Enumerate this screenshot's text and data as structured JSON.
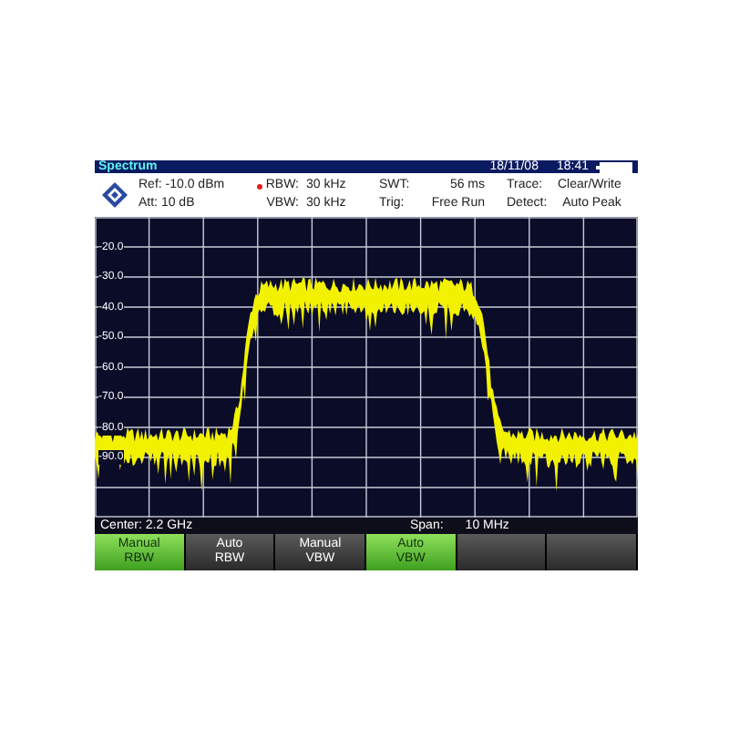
{
  "title_bar": {
    "title": "Spectrum",
    "date": "18/11/08",
    "time": "18:41"
  },
  "header": {
    "ref": "Ref: -10.0 dBm",
    "att": "Att: 10 dB",
    "rbw_label": "RBW:",
    "rbw_value": "30 kHz",
    "rbw_marked": true,
    "vbw_label": "VBW:",
    "vbw_value": "30 kHz",
    "swt_label": "SWT:",
    "swt_value": "56 ms",
    "trig_label": "Trig:",
    "trig_value": "Free Run",
    "trace_label": "Trace:",
    "trace_value": "Clear/Write",
    "detect_label": "Detect:",
    "detect_value": "Auto Peak"
  },
  "plot": {
    "y_labels": [
      "-20.0",
      "-30.0",
      "-40.0",
      "-50.0",
      "-60.0",
      "-70.0",
      "-80.0",
      "-90.0"
    ]
  },
  "footer": {
    "center": "Center: 2.2 GHz",
    "span": "Span:",
    "span_value": "10 MHz"
  },
  "softkeys": [
    {
      "line1": "Manual",
      "line2": "RBW",
      "selected": true
    },
    {
      "line1": "Auto",
      "line2": "RBW",
      "selected": false
    },
    {
      "line1": "Manual",
      "line2": "VBW",
      "selected": false
    },
    {
      "line1": "Auto",
      "line2": "VBW",
      "selected": true
    },
    {
      "selected": false
    },
    {
      "selected": false
    }
  ]
}
